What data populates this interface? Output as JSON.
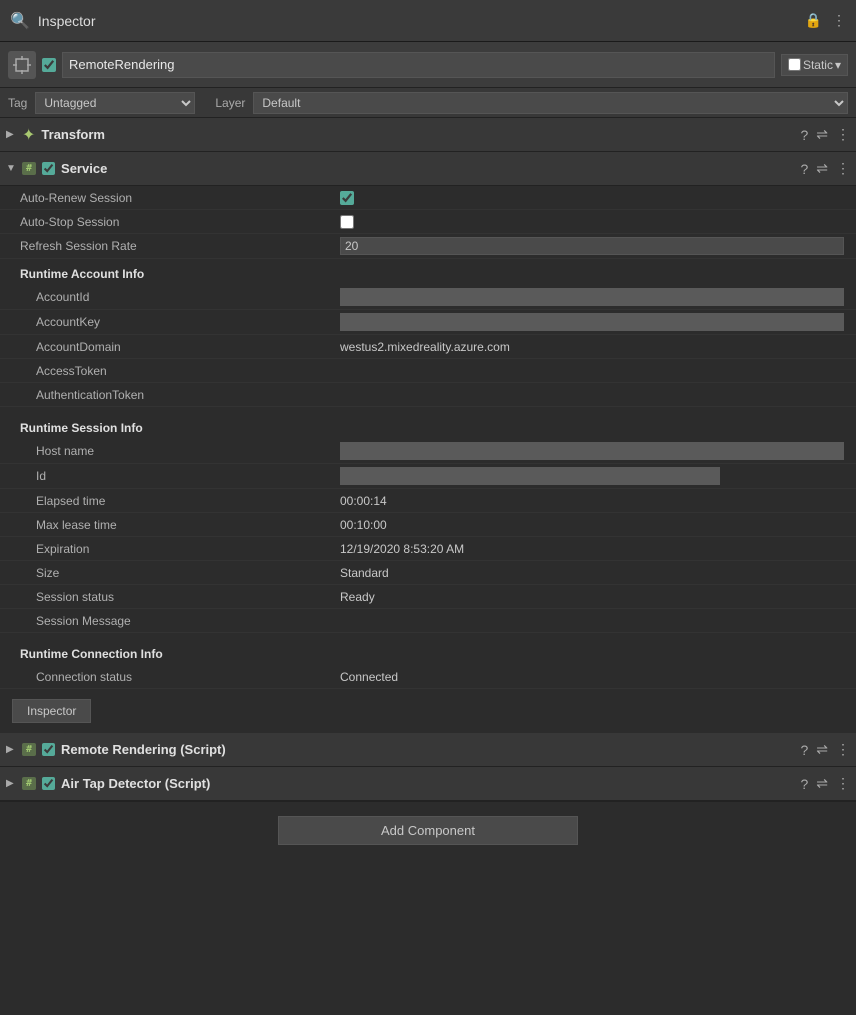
{
  "titleBar": {
    "title": "Inspector",
    "lockIcon": "🔒",
    "dotsIcon": "⋮"
  },
  "gameObject": {
    "name": "RemoteRendering",
    "checked": true,
    "staticLabel": "Static",
    "chevronDown": "▾"
  },
  "tagLayer": {
    "tagLabel": "Tag",
    "tagValue": "Untagged",
    "layerLabel": "Layer",
    "layerValue": "Default"
  },
  "transform": {
    "name": "Transform",
    "helpIcon": "?",
    "settingsIcon": "⇌",
    "dotsIcon": "⋮"
  },
  "service": {
    "name": "Service",
    "helpIcon": "?",
    "settingsIcon": "⇌",
    "dotsIcon": "⋮",
    "fields": {
      "autoRenewSession": {
        "label": "Auto-Renew Session",
        "checked": true
      },
      "autoStopSession": {
        "label": "Auto-Stop Session",
        "checked": false
      },
      "refreshSessionRate": {
        "label": "Refresh Session Rate",
        "value": "20"
      }
    },
    "runtimeAccountInfo": {
      "sectionLabel": "Runtime Account Info",
      "accountId": {
        "label": "AccountId",
        "value": ""
      },
      "accountKey": {
        "label": "AccountKey",
        "value": ""
      },
      "accountDomain": {
        "label": "AccountDomain",
        "value": "westus2.mixedreality.azure.com"
      },
      "accessToken": {
        "label": "AccessToken",
        "value": ""
      },
      "authenticationToken": {
        "label": "AuthenticationToken",
        "value": ""
      }
    },
    "runtimeSessionInfo": {
      "sectionLabel": "Runtime Session Info",
      "hostName": {
        "label": "Host name",
        "value": ""
      },
      "id": {
        "label": "Id",
        "value": ""
      },
      "elapsedTime": {
        "label": "Elapsed time",
        "value": "00:00:14"
      },
      "maxLeaseTime": {
        "label": "Max lease time",
        "value": "00:10:00"
      },
      "expiration": {
        "label": "Expiration",
        "value": "12/19/2020 8:53:20 AM"
      },
      "size": {
        "label": "Size",
        "value": "Standard"
      },
      "sessionStatus": {
        "label": "Session status",
        "value": "Ready"
      },
      "sessionMessage": {
        "label": "Session Message",
        "value": ""
      }
    },
    "runtimeConnectionInfo": {
      "sectionLabel": "Runtime Connection Info",
      "connectionStatus": {
        "label": "Connection status",
        "value": "Connected"
      }
    }
  },
  "inspectorTab": {
    "label": "Inspector"
  },
  "scriptComponents": [
    {
      "name": "Remote Rendering (Script)"
    },
    {
      "name": "Air Tap Detector (Script)"
    }
  ],
  "addComponent": {
    "label": "Add Component"
  }
}
